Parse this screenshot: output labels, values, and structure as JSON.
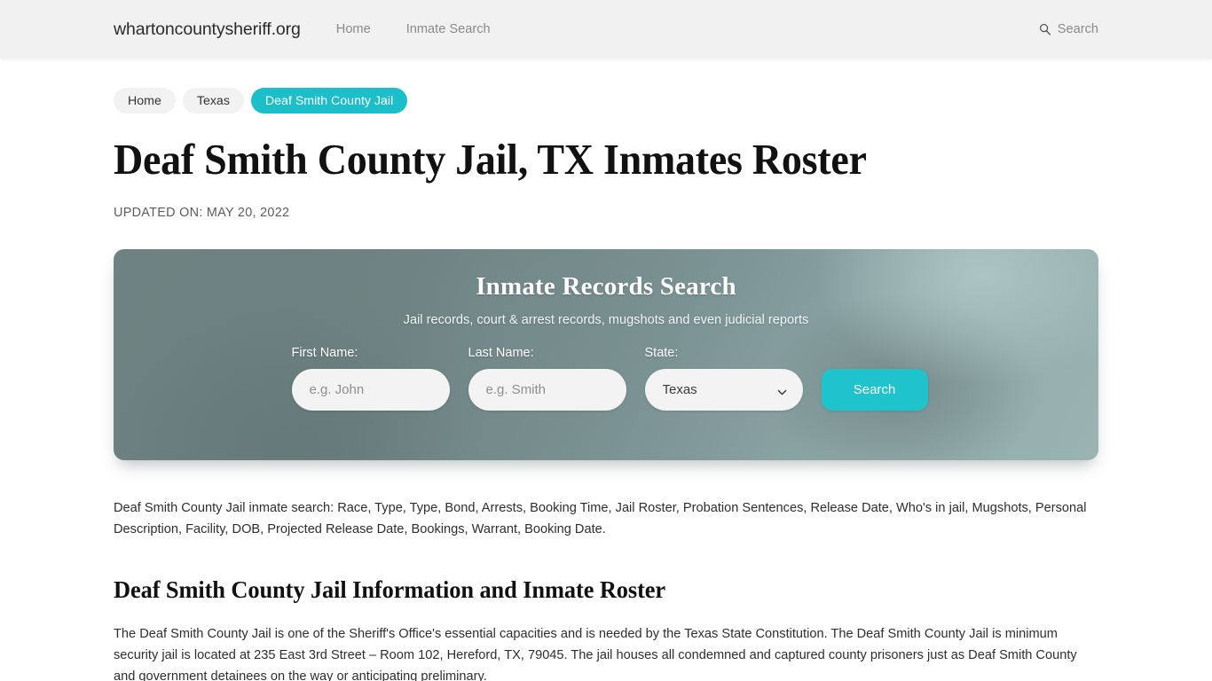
{
  "header": {
    "brand": "whartoncountysheriff.org",
    "nav": [
      {
        "label": "Home"
      },
      {
        "label": "Inmate Search"
      }
    ],
    "search": {
      "icon": "search-icon",
      "label": "Search"
    }
  },
  "breadcrumb": [
    {
      "label": "Home",
      "current": false
    },
    {
      "label": "Texas",
      "current": false
    },
    {
      "label": "Deaf Smith County Jail",
      "current": true
    }
  ],
  "article": {
    "title": "Deaf Smith County Jail, TX Inmates Roster",
    "updated": "UPDATED ON: MAY 20, 2022",
    "keywords": "Deaf Smith County Jail inmate search: Race, Type, Type, Bond, Arrests, Booking Time, Jail Roster, Probation Sentences, Release Date, Who's in jail, Mugshots, Personal Description, Facility, DOB, Projected Release Date, Bookings, Warrant, Booking Date.",
    "section_heading": "Deaf Smith County Jail Information and Inmate Roster",
    "paragraph": "The Deaf Smith County Jail is one of the Sheriff's Office's essential capacities and is needed by the Texas State Constitution. The Deaf Smith County Jail is minimum security jail is located at 235 East 3rd Street – Room 102, Hereford, TX, 79045. The jail houses all condemned and captured county prisoners just as Deaf Smith County and government detainees on the way or anticipating preliminary."
  },
  "search_panel": {
    "title": "Inmate Records Search",
    "subtitle": "Jail records, court & arrest records, mugshots and even judicial reports",
    "fields": {
      "first_name": {
        "label": "First Name:",
        "value": "",
        "placeholder": "e.g. John"
      },
      "last_name": {
        "label": "Last Name:",
        "value": "",
        "placeholder": "e.g. Smith"
      },
      "state": {
        "label": "State:",
        "selected": "Texas"
      }
    },
    "submit_label": "Search"
  },
  "colors": {
    "accent_teal": "#1fc3cc",
    "breadcrumb_active": "#1cbfc9",
    "header_bg": "#f1f1f1",
    "panel_base": "#7d9597",
    "text": "#2e2e2e"
  }
}
